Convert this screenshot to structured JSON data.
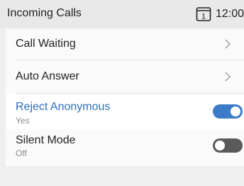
{
  "status_bar": {
    "title": "Incoming Calls",
    "line_icon": "line-1-icon",
    "line_number": "1",
    "time": "12:00"
  },
  "menu": {
    "items": [
      {
        "label": "Call Waiting",
        "type": "submenu",
        "icon": "chevron-right-icon"
      },
      {
        "label": "Auto Answer",
        "type": "submenu",
        "icon": "chevron-right-icon"
      },
      {
        "label": "Reject Anonymous",
        "value": "Yes",
        "type": "toggle",
        "state": "on",
        "selected": true
      },
      {
        "label": "Silent Mode",
        "value": "Off",
        "type": "toggle",
        "state": "off",
        "selected": false
      }
    ]
  },
  "colors": {
    "accent": "#3b7bc8",
    "selected_text": "#2f6fb8",
    "toggle_off": "#5a5a5a",
    "background": "#efefef",
    "panel": "#fafafa"
  }
}
